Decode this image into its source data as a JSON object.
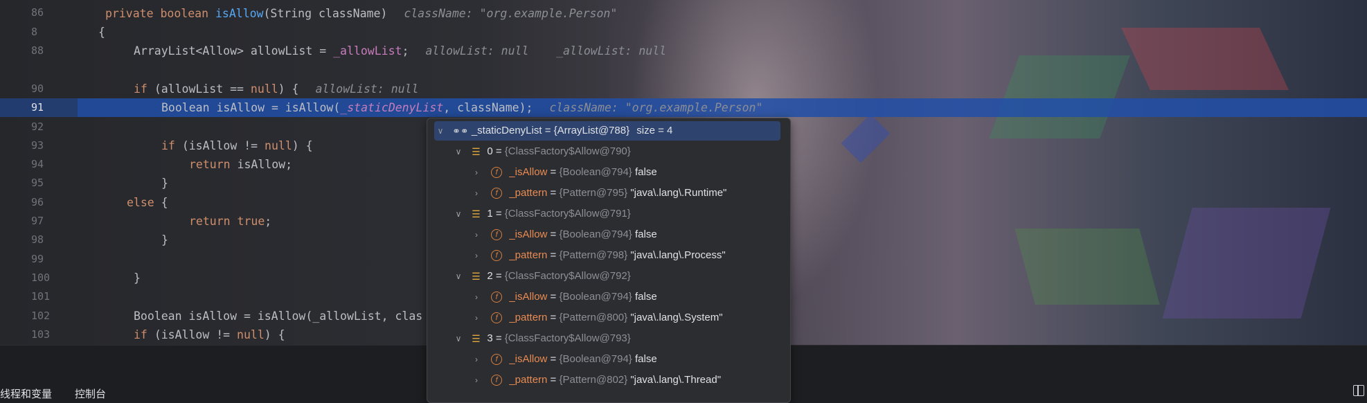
{
  "editor": {
    "line_numbers": [
      "86",
      "8",
      "88",
      "",
      "90",
      "91",
      "92",
      "93",
      "94",
      "95",
      "96",
      "97",
      "98",
      "99",
      "100",
      "101",
      "102",
      "103"
    ],
    "lines": {
      "l86": {
        "a": "private boolean ",
        "b": "isAllow",
        "c": "(String className)",
        "hint": "className: \"org.example.Person\""
      },
      "l87": {
        "a": "{"
      },
      "l88": {
        "a": "ArrayList<Allow> allowList = ",
        "b": "_allowList",
        "c": ";",
        "hint": "allowList: null    _allowList: null"
      },
      "l90": {
        "a": "if ",
        "b": "(allowList == ",
        "c": "null",
        "d": ") {",
        "hint": "allowList: null"
      },
      "l91": {
        "a": "Boolean isAllow = isAllow(",
        "b": "_staticDenyList",
        "c": ", className);",
        "hint": "className: \"org.example.Person\""
      },
      "l93": {
        "a": "if ",
        "b": "(isAllow != ",
        "c": "null",
        "d": ") {"
      },
      "l94": {
        "a": "return ",
        "b": "isAllow;"
      },
      "l95": {
        "a": "}"
      },
      "l96": {
        "a": "else ",
        "b": "{"
      },
      "l97": {
        "a": "return ",
        "b": "true",
        "c": ";"
      },
      "l98": {
        "a": "}"
      },
      "l100": {
        "a": "}"
      },
      "l102": {
        "a": "Boolean isAllow = isAllow(_allowList, clas"
      },
      "l103": {
        "a": "if ",
        "b": "(isAllow != ",
        "c": "null",
        "d": ") {"
      }
    }
  },
  "popup": {
    "root": {
      "name": "_staticDenyList",
      "eq": " = ",
      "type": "{ArrayList@788}",
      "size": "size = 4"
    },
    "items": [
      {
        "index": "0 = ",
        "type": "{ClassFactory$Allow@790}",
        "isallow_name": "_isAllow",
        "isallow_type": "{Boolean@794}",
        "isallow_val": "false",
        "pattern_name": "_pattern",
        "pattern_type": "{Pattern@795}",
        "pattern_val": "\"java\\.lang\\.Runtime\""
      },
      {
        "index": "1 = ",
        "type": "{ClassFactory$Allow@791}",
        "isallow_name": "_isAllow",
        "isallow_type": "{Boolean@794}",
        "isallow_val": "false",
        "pattern_name": "_pattern",
        "pattern_type": "{Pattern@798}",
        "pattern_val": "\"java\\.lang\\.Process\""
      },
      {
        "index": "2 = ",
        "type": "{ClassFactory$Allow@792}",
        "isallow_name": "_isAllow",
        "isallow_type": "{Boolean@794}",
        "isallow_val": "false",
        "pattern_name": "_pattern",
        "pattern_type": "{Pattern@800}",
        "pattern_val": "\"java\\.lang\\.System\""
      },
      {
        "index": "3 = ",
        "type": "{ClassFactory$Allow@793}",
        "isallow_name": "_isAllow",
        "isallow_type": "{Boolean@794}",
        "isallow_val": "false",
        "pattern_name": "_pattern",
        "pattern_type": "{Pattern@802}",
        "pattern_val": "\"java\\.lang\\.Thread\""
      }
    ],
    "eq": " = "
  },
  "bottom": {
    "tab_threads": "线程和变量",
    "tab_console": "控制台"
  },
  "colors": {
    "highlight": "#214fa8",
    "keyword": "#cf8e6d",
    "method": "#56a8f5",
    "field": "#c77dbb"
  }
}
